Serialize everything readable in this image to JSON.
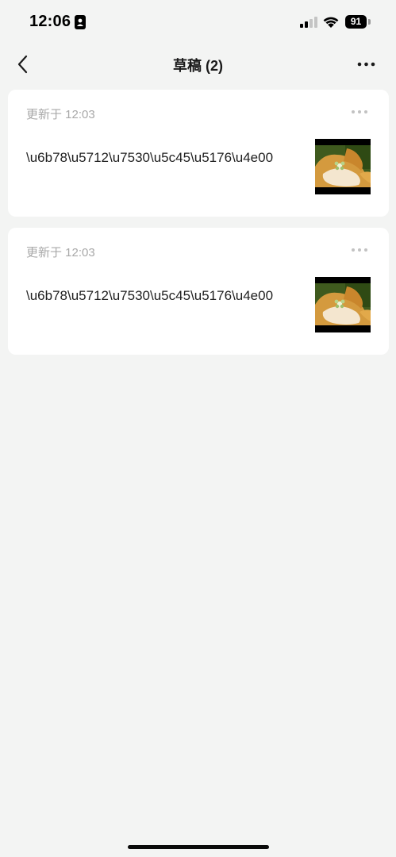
{
  "status_bar": {
    "time": "12:06",
    "battery_level": "91",
    "icons": [
      "id-card-icon",
      "signal-icon",
      "wifi-icon",
      "battery-icon"
    ]
  },
  "nav": {
    "back_icon": "chevron-left-icon",
    "title": "草稿 (2)",
    "more_icon": "more-horizontal-icon"
  },
  "drafts": [
    {
      "updated": "更新于 12:03",
      "text": "\\u6b78\\u5712\\u7530\\u5c45\\u5176\\u4e00",
      "more_icon": "more-horizontal-icon",
      "thumbnail": "flower-photo"
    },
    {
      "updated": "更新于 12:03",
      "text": "\\u6b78\\u5712\\u7530\\u5c45\\u5176\\u4e00",
      "more_icon": "more-horizontal-icon",
      "thumbnail": "flower-photo"
    }
  ],
  "colors": {
    "background": "#f3f4f3",
    "card": "#ffffff",
    "meta_text": "#a8a8a8",
    "body_text": "#1f1f1f"
  }
}
